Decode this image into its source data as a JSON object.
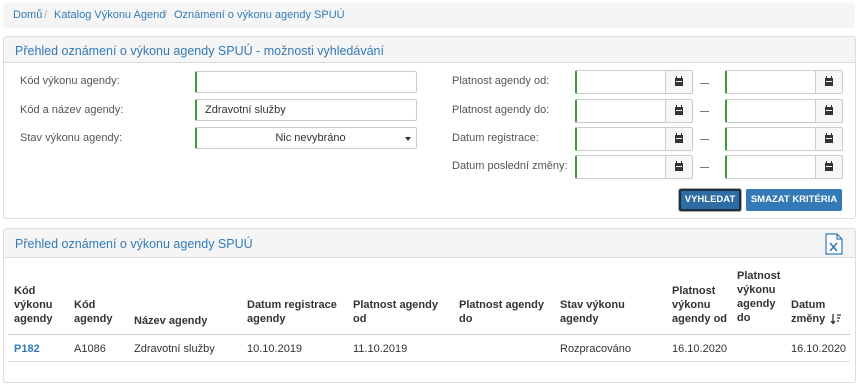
{
  "breadcrumb": {
    "items": [
      "Domů",
      "Katalog Výkonu Agend",
      "Oznámení o výkonu agendy SPUÚ"
    ],
    "separator": "/"
  },
  "search_panel": {
    "title": "Přehled oznámení o výkonu agendy SPUÚ - možnosti vyhledávání",
    "kod_label": "Kód výkonu agendy:",
    "kod_value": "",
    "nazev_label": "Kód a název agendy:",
    "nazev_value": "Zdravotní služby",
    "stav_label": "Stav výkonu agendy:",
    "stav_value": "Nic nevybráno",
    "platnost_od_label": "Platnost agendy od:",
    "platnost_do_label": "Platnost agendy do:",
    "registrace_label": "Datum registrace:",
    "zmena_label": "Datum poslední změny:",
    "range_separator": "—",
    "search_button": "VYHLEDAT",
    "clear_button": "SMAZAT KRITÉRIA"
  },
  "results_panel": {
    "title": "Přehled oznámení o výkonu agendy SPUÚ",
    "export_icon": "excel-export-icon",
    "columns": [
      "Kód výkonu agendy",
      "Kód agendy",
      "Název agendy",
      "Datum registrace agendy",
      "Platnost agendy od",
      "Platnost agendy do",
      "Stav výkonu agendy",
      "Platnost výkonu agendy od",
      "Platnost výkonu agendy do",
      "Datum změny"
    ],
    "sort_icon": "sort-desc-icon",
    "rows": [
      [
        "P182",
        "A1086",
        "Zdravotní služby",
        "10.10.2019",
        "11.10.2019",
        "",
        "Rozpracováno",
        "16.10.2020",
        "",
        "16.10.2020"
      ]
    ]
  },
  "colors": {
    "link": "#337ab7",
    "required_border": "#3c9a3c",
    "button": "#337ab7"
  }
}
